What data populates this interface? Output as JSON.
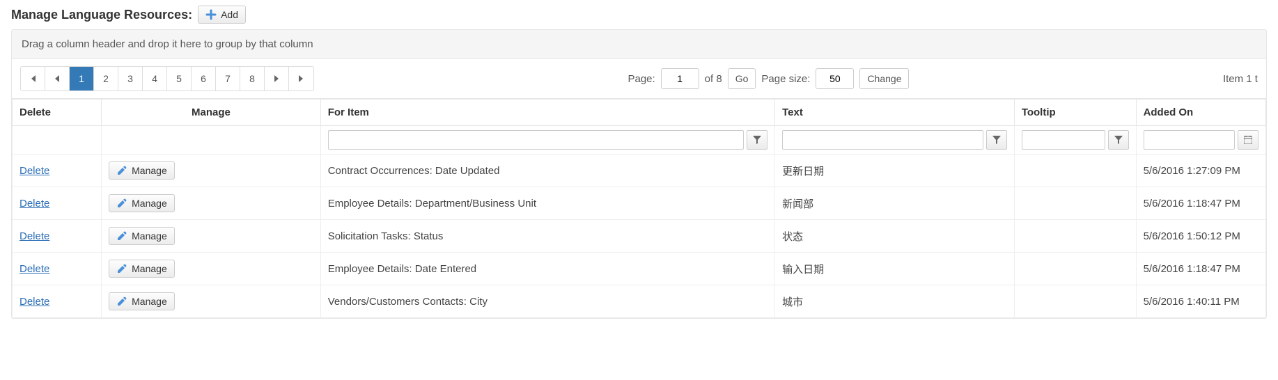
{
  "title": "Manage Language Resources:",
  "add_button_label": "Add",
  "group_hint": "Drag a column header and drop it here to group by that column",
  "pager": {
    "pages": [
      "1",
      "2",
      "3",
      "4",
      "5",
      "6",
      "7",
      "8"
    ],
    "active_page": "1",
    "page_label": "Page:",
    "page_value": "1",
    "of_text": "of 8",
    "go_label": "Go",
    "pagesize_label": "Page size:",
    "pagesize_value": "50",
    "change_label": "Change",
    "summary": "Item 1 t"
  },
  "columns": {
    "delete": "Delete",
    "manage": "Manage",
    "for_item": "For Item",
    "text": "Text",
    "tooltip": "Tooltip",
    "added_on": "Added On"
  },
  "labels": {
    "delete_link": "Delete",
    "manage_btn": "Manage"
  },
  "rows": [
    {
      "for_item": "Contract Occurrences: Date Updated",
      "text": "更新日期",
      "tooltip": "",
      "added_on": "5/6/2016 1:27:09 PM"
    },
    {
      "for_item": "Employee Details: Department/Business Unit",
      "text": "新闻部",
      "tooltip": "",
      "added_on": "5/6/2016 1:18:47 PM"
    },
    {
      "for_item": "Solicitation Tasks: Status",
      "text": "状态",
      "tooltip": "",
      "added_on": "5/6/2016 1:50:12 PM"
    },
    {
      "for_item": "Employee Details: Date Entered",
      "text": "输入日期",
      "tooltip": "",
      "added_on": "5/6/2016 1:18:47 PM"
    },
    {
      "for_item": "Vendors/Customers Contacts: City",
      "text": "城市",
      "tooltip": "",
      "added_on": "5/6/2016 1:40:11 PM"
    }
  ]
}
